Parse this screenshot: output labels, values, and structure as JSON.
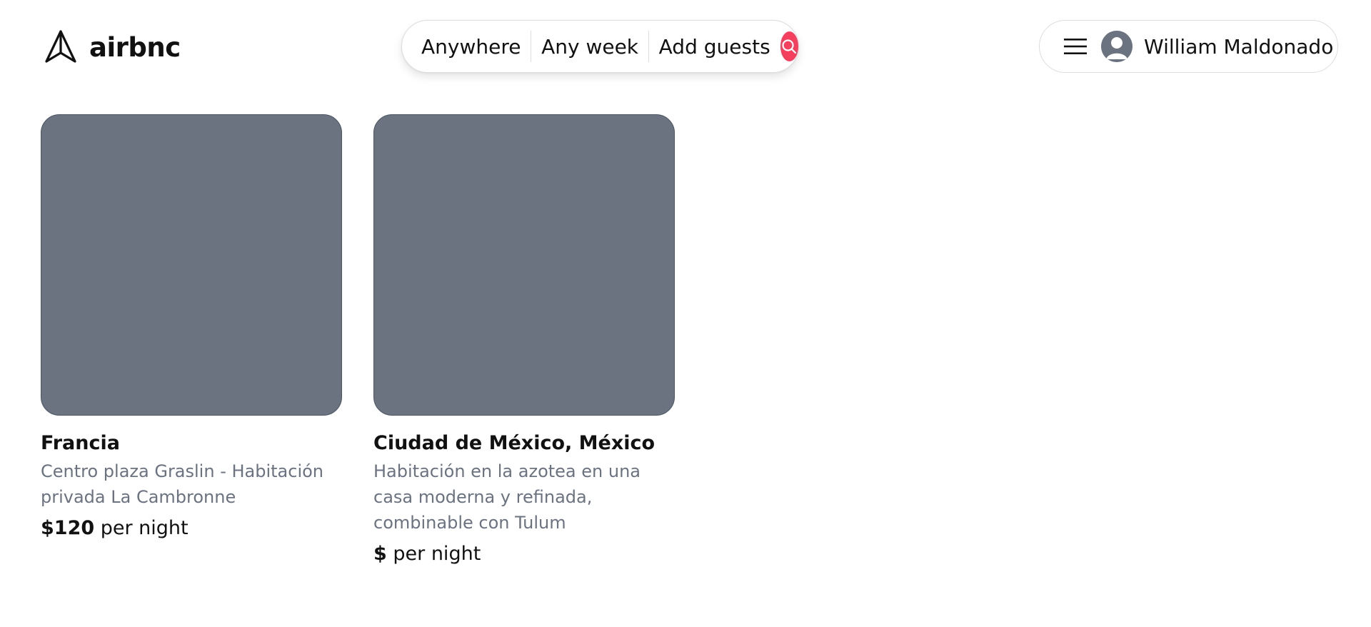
{
  "brand": {
    "name": "airbnc"
  },
  "search": {
    "location": "Anywhere",
    "dates": "Any week",
    "guests": "Add guests"
  },
  "user": {
    "name": "William Maldonado"
  },
  "listings": [
    {
      "title": "Francia",
      "description": "Centro plaza Graslin - Habitación privada La Cambronne",
      "price": "$120",
      "price_suffix": "per night"
    },
    {
      "title": "Ciudad de México, México",
      "description": "Habitación en la azotea en una casa moderna y refinada, combinable con Tulum",
      "price": "$",
      "price_suffix": "per night"
    }
  ],
  "colors": {
    "accent": "#f43f5e",
    "placeholder_image": "#6b7280",
    "muted_text": "#6b7280",
    "border": "#dddddd"
  },
  "icons": {
    "logo": "paper-plane-logo-icon",
    "search": "search-icon",
    "menu": "hamburger-menu-icon",
    "avatar": "user-avatar-icon"
  }
}
